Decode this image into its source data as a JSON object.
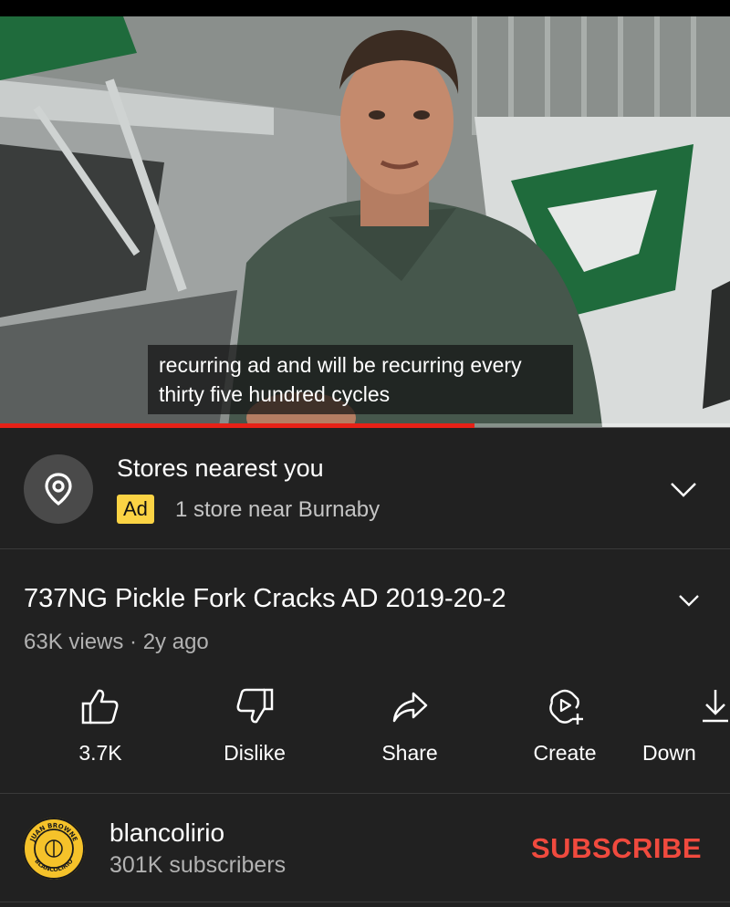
{
  "video": {
    "caption_lines": [
      "recurring ad and will be recurring every",
      "thirty five hundred cycles"
    ],
    "progress_fraction": 0.65,
    "progress_color": "#e62117"
  },
  "ad": {
    "icon": "location-pin-icon",
    "title": "Stores nearest you",
    "badge": "Ad",
    "badge_color": "#fbd344",
    "subtitle": "1 store near Burnaby",
    "expand_icon": "chevron-down-icon"
  },
  "details": {
    "title": "737NG Pickle Fork Cracks AD 2019-20-2",
    "meta": "63K views · 2y ago",
    "expand_icon": "chevron-down-icon"
  },
  "actions": [
    {
      "icon": "thumbs-up-icon",
      "label": "3.7K"
    },
    {
      "icon": "thumbs-down-icon",
      "label": "Dislike"
    },
    {
      "icon": "share-icon",
      "label": "Share"
    },
    {
      "icon": "create-icon",
      "label": "Create"
    },
    {
      "icon": "download-icon",
      "label": "Down"
    }
  ],
  "channel": {
    "avatar_icon": "channel-avatar-logo",
    "avatar_logo_text": [
      "JUAN BROWNE",
      "BLANCOLIRIO"
    ],
    "name": "blancolirio",
    "subscribers": "301K subscribers",
    "subscribe_label": "SUBSCRIBE",
    "subscribe_color": "#f04a3e"
  }
}
